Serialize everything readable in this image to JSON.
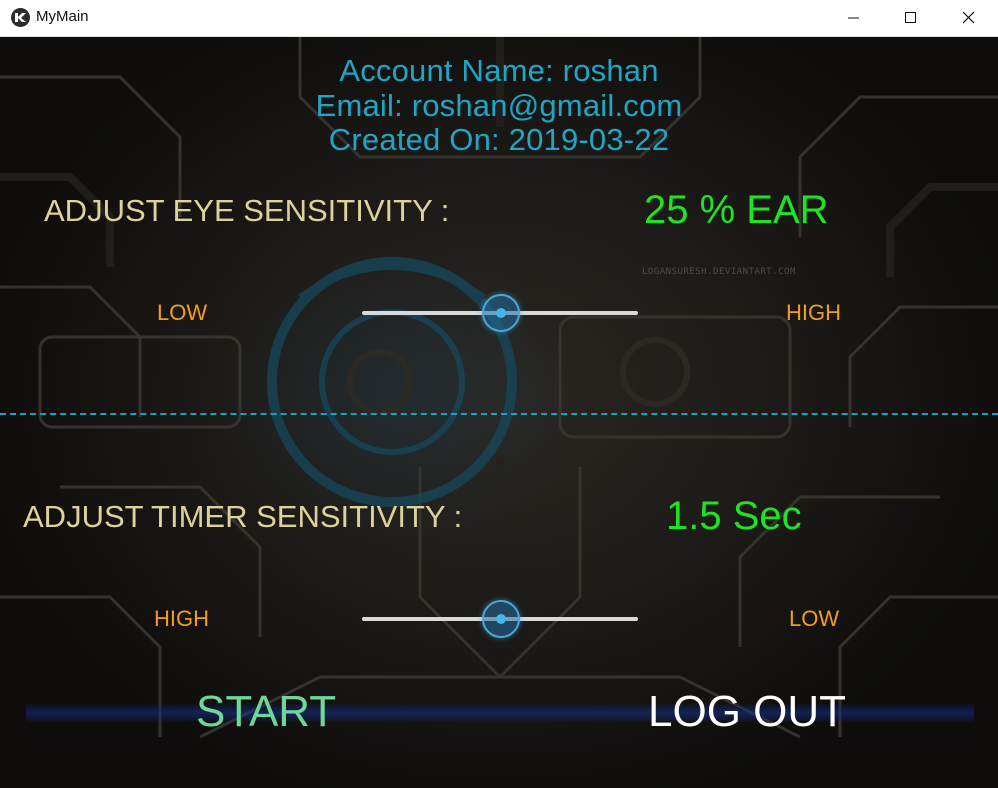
{
  "window": {
    "title": "MyMain",
    "controls": [
      "minimize",
      "maximize",
      "close"
    ]
  },
  "account": {
    "name_line": "Account Name: roshan",
    "email_line": "Email: roshan@gmail.com",
    "created_line": "Created On: 2019-03-22"
  },
  "eye": {
    "heading": "ADJUST EYE SENSITIVITY :",
    "value": "25 % EAR",
    "min_label": "LOW",
    "max_label": "HIGH",
    "slider_fraction": 0.5
  },
  "timer": {
    "heading": "ADJUST TIMER SENSITIVITY :",
    "value": "1.5 Sec",
    "min_label": "HIGH",
    "max_label": "LOW",
    "slider_fraction": 0.5
  },
  "actions": {
    "start_label": "START",
    "logout_label": "LOG OUT"
  },
  "background": {
    "watermark": "LOGANSURESH.DEVIANTART.COM"
  },
  "colors": {
    "info_text": "#1fa6c6",
    "heading_text": "#ded29b",
    "value_text": "#1ee524",
    "range_label": "#f29d1b",
    "slider_thumb": "#46b6ea",
    "start_button": "#6fd79a",
    "logout_button": "#ffffff",
    "divider": "#1b9fc3"
  },
  "icons": {
    "app": "kivy-logo-icon",
    "minimize": "minimize-icon",
    "maximize": "maximize-icon",
    "close": "close-icon"
  }
}
